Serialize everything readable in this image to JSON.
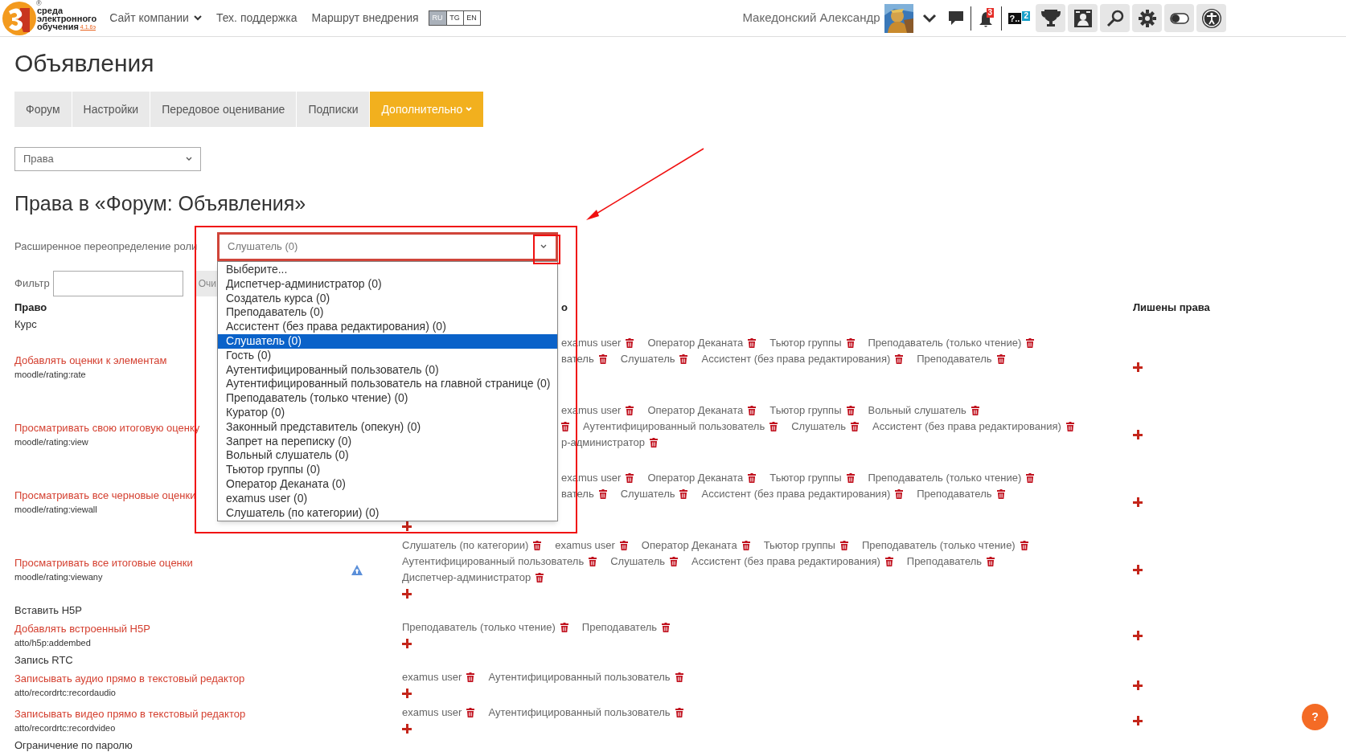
{
  "header": {
    "logo": {
      "lines": [
        "среда",
        "электронного",
        "обучения"
      ],
      "version": "4.1.6э",
      "mark": "®"
    },
    "nav": [
      {
        "label": "Сайт компании",
        "dropdown": true
      },
      {
        "label": "Тех. поддержка",
        "dropdown": false
      },
      {
        "label": "Маршрут внедрения",
        "dropdown": false
      }
    ],
    "languages": [
      {
        "label": "RU",
        "selected": true
      },
      {
        "label": "TG",
        "selected": false
      },
      {
        "label": "EN",
        "selected": false
      }
    ],
    "user": {
      "name": "Македонский Александр"
    },
    "notifications": {
      "count": "3"
    },
    "questions": {
      "label": "?..",
      "count": "2"
    }
  },
  "page_title": "Объявления",
  "tabs": [
    {
      "label": "Форум",
      "selected": false,
      "dropdown": false
    },
    {
      "label": "Настройки",
      "selected": false,
      "dropdown": false
    },
    {
      "label": "Передовое оценивание",
      "selected": false,
      "dropdown": false
    },
    {
      "label": "Подписки",
      "selected": false,
      "dropdown": false
    },
    {
      "label": "Дополнительно",
      "selected": true,
      "dropdown": true
    }
  ],
  "section_select": {
    "value": "Права"
  },
  "heading": "Права в «Форум: Объявления»",
  "role_override": {
    "label": "Расширенное переопределение роли",
    "value": "Слушатель (0)",
    "expanded": true,
    "options": [
      {
        "label": "Выберите...",
        "selected": false
      },
      {
        "label": "Диспетчер-администратор (0)",
        "selected": false
      },
      {
        "label": "Создатель курса (0)",
        "selected": false
      },
      {
        "label": "Преподаватель (0)",
        "selected": false
      },
      {
        "label": "Ассистент (без права редактирования) (0)",
        "selected": false
      },
      {
        "label": "Слушатель (0)",
        "selected": true
      },
      {
        "label": "Гость (0)",
        "selected": false
      },
      {
        "label": "Аутентифицированный пользователь (0)",
        "selected": false
      },
      {
        "label": "Аутентифицированный пользователь на главной странице (0)",
        "selected": false
      },
      {
        "label": "Преподаватель (только чтение) (0)",
        "selected": false
      },
      {
        "label": "Куратор (0)",
        "selected": false
      },
      {
        "label": "Законный представитель (опекун) (0)",
        "selected": false
      },
      {
        "label": "Запрет на переписку (0)",
        "selected": false
      },
      {
        "label": "Вольный слушатель (0)",
        "selected": false
      },
      {
        "label": "Тьютор группы (0)",
        "selected": false
      },
      {
        "label": "Оператор Деканата (0)",
        "selected": false
      },
      {
        "label": "examus user (0)",
        "selected": false
      },
      {
        "label": "Слушатель (по категории) (0)",
        "selected": false
      }
    ]
  },
  "filter": {
    "label": "Фильтр",
    "clear_button": "Очи"
  },
  "table": {
    "columns": [
      "Право",
      "о",
      "Лишены права"
    ],
    "rows": [
      {
        "kind": "section",
        "label": "Курс"
      },
      {
        "kind": "capability",
        "name": "Добавлять оценки к элементам",
        "code": "moodle/rating:rate",
        "risk": false,
        "under_menu": true,
        "covered_line": true,
        "add_button": false,
        "allowed": [
          [
            {
              "text": "examus user"
            },
            {
              "text": "Оператор Деканата"
            },
            {
              "text": "Тьютор группы"
            },
            {
              "text": "Преподаватель (только чтение)"
            }
          ],
          [
            {
              "text": "ватель"
            },
            {
              "text": "Слушатель"
            },
            {
              "text": "Ассистент (без права редактирования)"
            },
            {
              "text": "Преподаватель"
            }
          ]
        ]
      },
      {
        "kind": "capability",
        "name": "Просматривать свою итоговую оценку",
        "code": "moodle/rating:view",
        "risk": false,
        "under_menu": true,
        "covered_line": false,
        "add_button": false,
        "allowed": [
          [
            {
              "text": "examus user"
            },
            {
              "text": "Оператор Деканата"
            },
            {
              "text": "Тьютор группы"
            },
            {
              "text": "Вольный слушатель"
            }
          ],
          [
            {
              "kind": "icon_only"
            },
            {
              "text": "Аутентифицированный пользователь"
            },
            {
              "text": "Слушатель"
            },
            {
              "text": "Ассистент (без права редактирования)"
            }
          ],
          [
            {
              "text": "р-администратор"
            }
          ]
        ]
      },
      {
        "kind": "capability",
        "name": "Просматривать все черновые оценки",
        "code": "moodle/rating:viewall",
        "risk": false,
        "under_menu": true,
        "covered_line": true,
        "add_button": true,
        "allowed": [
          [
            {
              "text": "examus user"
            },
            {
              "text": "Оператор Деканата"
            },
            {
              "text": "Тьютор группы"
            },
            {
              "text": "Преподаватель (только чтение)"
            }
          ],
          [
            {
              "text": "ватель"
            },
            {
              "text": "Слушатель"
            },
            {
              "text": "Ассистент (без права редактирования)"
            },
            {
              "text": "Преподаватель"
            }
          ]
        ]
      },
      {
        "kind": "capability",
        "name": "Просматривать все итоговые оценки",
        "code": "moodle/rating:viewany",
        "risk": true,
        "under_menu": false,
        "add_button": true,
        "allowed": [
          [
            {
              "text": "Слушатель (по категории)"
            },
            {
              "text": "examus user"
            },
            {
              "text": "Оператор Деканата"
            },
            {
              "text": "Тьютор группы"
            },
            {
              "text": "Преподаватель (только чтение)"
            }
          ],
          [
            {
              "text": "Аутентифицированный пользователь"
            },
            {
              "text": "Слушатель"
            },
            {
              "text": "Ассистент (без права редактирования)"
            },
            {
              "text": "Преподаватель"
            }
          ],
          [
            {
              "text": "Диспетчер-администратор"
            }
          ]
        ]
      },
      {
        "kind": "section",
        "label": "Вставить H5P"
      },
      {
        "kind": "capability",
        "name": "Добавлять встроенный H5P",
        "code": "atto/h5p:addembed",
        "risk": false,
        "under_menu": false,
        "add_button": true,
        "allowed": [
          [
            {
              "text": "Преподаватель (только чтение)"
            },
            {
              "text": "Преподаватель"
            }
          ]
        ]
      },
      {
        "kind": "section",
        "label": "Запись RTC"
      },
      {
        "kind": "capability",
        "name": "Записывать аудио прямо в текстовый редактор",
        "code": "atto/recordrtc:recordaudio",
        "risk": false,
        "under_menu": false,
        "add_button": true,
        "allowed": [
          [
            {
              "text": "examus user"
            },
            {
              "text": "Аутентифицированный пользователь"
            }
          ]
        ]
      },
      {
        "kind": "capability",
        "name": "Записывать видео прямо в текстовый редактор",
        "code": "atto/recordrtc:recordvideo",
        "risk": false,
        "under_menu": false,
        "add_button": true,
        "allowed": [
          [
            {
              "text": "examus user"
            },
            {
              "text": "Аутентифицированный пользователь"
            }
          ]
        ]
      },
      {
        "kind": "section",
        "label": "Ограничение по паролю"
      }
    ]
  },
  "annotations": [
    {
      "kind": "frame"
    },
    {
      "kind": "small_frame"
    },
    {
      "kind": "arrow"
    }
  ],
  "help_button": {
    "label": "?"
  }
}
